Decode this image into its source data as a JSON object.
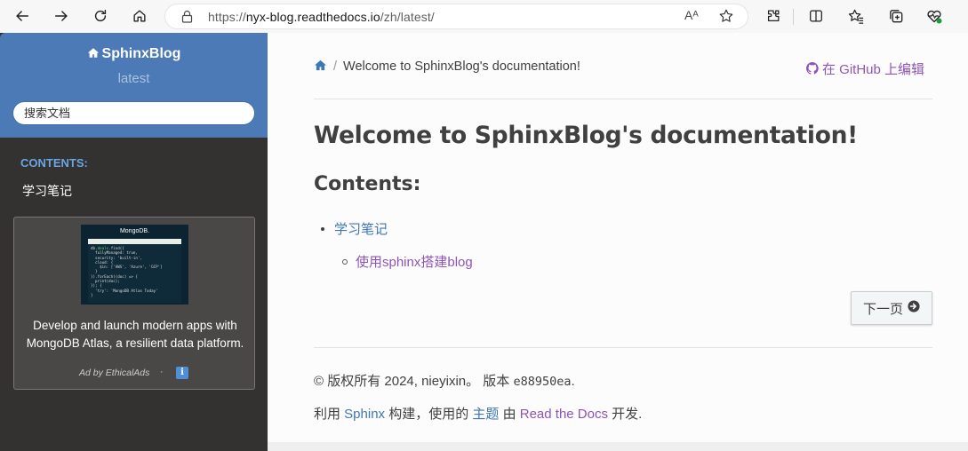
{
  "browser": {
    "url_prefix": "https://",
    "url_host": "nyx-blog.readthedocs.io",
    "url_path": "/zh/latest/",
    "read_aloud": "Aᴬ"
  },
  "sidebar": {
    "brand": "SphinxBlog",
    "version": "latest",
    "search_placeholder": "搜索文档",
    "caption": "CONTENTS:",
    "toc_item": "学习笔记"
  },
  "ad": {
    "image_logo": "MongoDB.",
    "text_line1": "Develop and launch modern apps with",
    "text_line2": "MongoDB Atlas, a resilient data platform.",
    "by": "Ad by EthicalAds",
    "dot": "·",
    "info": "i"
  },
  "content": {
    "breadcrumb_current": "Welcome to SphinxBlog's documentation!",
    "breadcrumb_sep": "/",
    "edit_on_github": "在 GitHub 上编辑",
    "title": "Welcome to SphinxBlog's documentation!",
    "subtitle": "Contents:",
    "toc_level1": "学习笔记",
    "toc_level2": "使用sphinx搭建blog",
    "next_button": "下一页"
  },
  "footer": {
    "copyright": "© 版权所有 2024, nieyixin。 版本 ",
    "revision": "e88950ea",
    "revision_end": ".",
    "built_prefix": "利用 ",
    "sphinx_link": "Sphinx",
    "built_mid": " 构建，使用的 ",
    "theme_link": "主题",
    "built_by": " 由 ",
    "rtd_link": "Read the Docs",
    "built_end": " 开发."
  },
  "colors": {
    "sidebar_top": "#4b7ab6",
    "sidebar_bg": "#343131",
    "link_blue": "#3d77b4",
    "link_purple": "#8f54b6"
  }
}
